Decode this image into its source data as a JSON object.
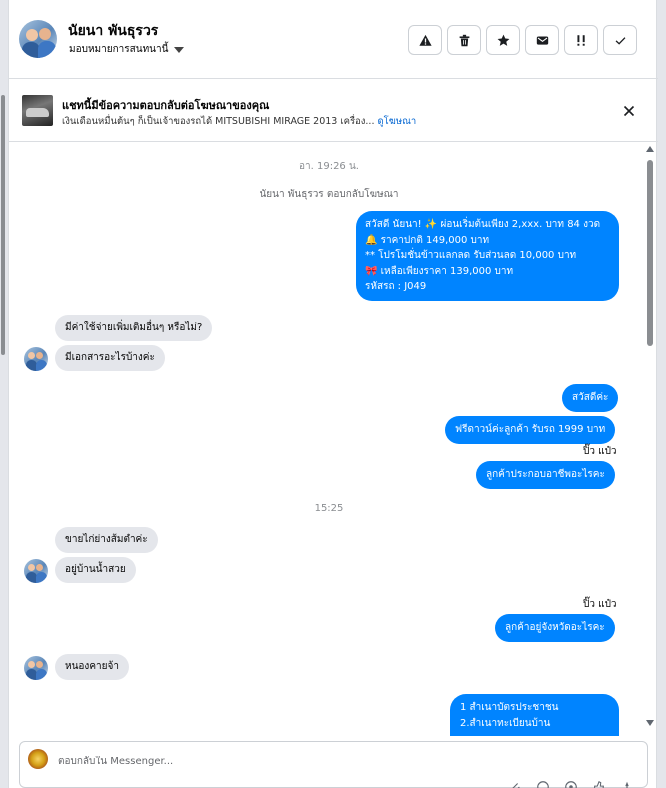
{
  "header": {
    "contact_name": "นัยนา พันธุรวร",
    "assign_label": "มอบหมายการสนทนานี้"
  },
  "actions": [
    {
      "name": "report-spam-button",
      "icon": "warning-icon"
    },
    {
      "name": "delete-button",
      "icon": "trash-icon"
    },
    {
      "name": "star-button",
      "icon": "star-icon"
    },
    {
      "name": "mark-unread-button",
      "icon": "mail-icon"
    },
    {
      "name": "follow-up-button",
      "icon": "important-icon"
    },
    {
      "name": "mark-done-button",
      "icon": "check-icon"
    }
  ],
  "ad": {
    "title": "แชทนี้มีข้อความตอบกลับต่อโฆษณาของคุณ",
    "description": "เงินเดือนหมื่นต้นๆ ก็เป็นเจ้าของรถได้ MITSUBISHI MIRAGE 2013 เครื่อง...",
    "link": "ดูโฆษณา"
  },
  "chat": {
    "timestamp_1": "อา. 19:26 น.",
    "reply_note": "นัยนา พันธุรวร ตอบกลับโฆษณา",
    "promo_lines": [
      "สวัสดี นัยนา! ✨  ผ่อนเริ่มต้นเพียง 2,xxx. บาท 84 งวด",
      "🔔 ราคาปกติ 149,000 บาท",
      "** โปรโมชั่นข้าวแลกลด รับส่วนลด 10,000 บาท",
      "🎀 เหลือเพียงราคา 139,000 บาท",
      " รหัสรถ : J049"
    ],
    "in_1": "มีค่าใช้จ่ายเพิ่มเติมอื่นๆ หรือไม่?",
    "in_2": "มีเอกสารอะไรบ้างค่ะ",
    "out_1": "สวัสดีค่ะ",
    "out_2": "ฟรีดาวน์ค่ะลูกค้า  รับรถ 1999 บาท",
    "sender_1": "ปิ๊ว แป๋ว",
    "out_3": "ลูกค้าประกอบอาชีพอะไรคะ",
    "timestamp_2": "15:25",
    "in_3": "ขายไก่ย่างส้มตำค่ะ",
    "in_4": "อยู่บ้านน้ำสวย",
    "sender_2": "ปิ๊ว แป๋ว",
    "out_4": "ลูกค้าอยู่จังหวัดอะไรคะ",
    "in_5": "หนองคายจ้า",
    "doc_lines": [
      "1 สำเนาบัตรประชาชน",
      "2.สำเนาทะเบียนบ้าน"
    ]
  },
  "composer": {
    "placeholder": "ตอบกลับใน Messenger..."
  }
}
